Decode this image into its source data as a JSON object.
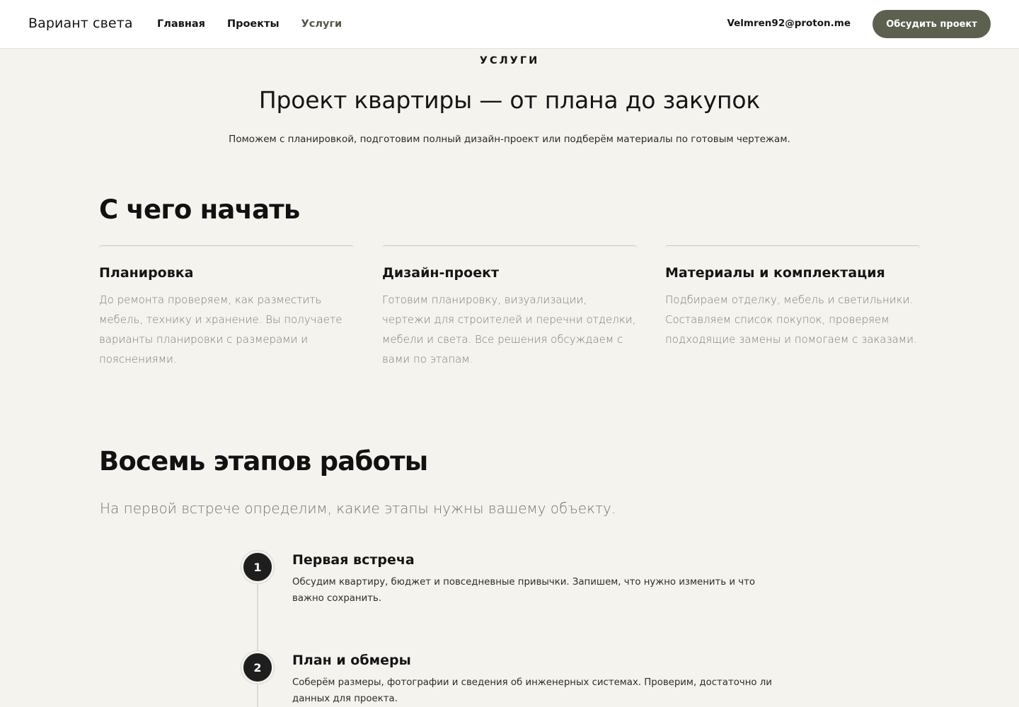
{
  "header": {
    "brand": "Вариант света",
    "nav": [
      "Главная",
      "Проекты",
      "Услуги"
    ],
    "email": "Velmren92@proton.me",
    "cta": "Обсудить проект"
  },
  "hero": {
    "eyebrow": "УСЛУГИ",
    "title": "Проект квартиры — от плана до закупок",
    "subtitle": "Поможем с планировкой, подготовим полный дизайн-проект или подберём материалы по готовым чертежам."
  },
  "start": {
    "title": "С чего начать",
    "cards": [
      {
        "title": "Планировка",
        "text": "До ремонта проверяем, как разместить мебель, технику и хранение. Вы получаете варианты планировки с размерами и пояснениями."
      },
      {
        "title": "Дизайн-проект",
        "text": "Готовим планировку, визуализации, чертежи для строителей и перечни отделки, мебели и света. Все решения обсуждаем с вами по этапам."
      },
      {
        "title": "Материалы и комплектация",
        "text": "Подбираем отделку, мебель и светильники. Составляем список покупок, проверяем подходящие замены и помогаем с заказами."
      }
    ]
  },
  "steps": {
    "title": "Восемь этапов работы",
    "lead": "На первой встрече определим, какие этапы нужны вашему объекту.",
    "items": [
      {
        "num": "1",
        "title": "Первая встреча",
        "text": "Обсудим квартиру, бюджет и повседневные привычки. Запишем, что нужно изменить и что важно сохранить."
      },
      {
        "num": "2",
        "title": "План и обмеры",
        "text": "Соберём размеры, фотографии и сведения об инженерных системах. Проверим, достаточно ли данных для проекта."
      }
    ]
  },
  "colors": {
    "background": "#f4f3ee",
    "header": "#ffffff",
    "accent": "#5b604f",
    "step_circle": "#1e1e1e"
  }
}
